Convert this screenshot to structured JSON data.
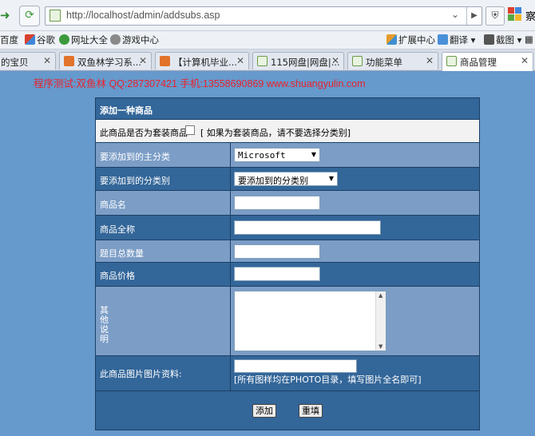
{
  "browser": {
    "url": "http://localhost/admin/addsubs.asp",
    "url_host_part": "http://localhost",
    "url_path_part": "/admin/addsubs.asp",
    "partial_right_text": "察"
  },
  "bookmarks": [
    {
      "label": "百度"
    },
    {
      "label": "谷歌"
    },
    {
      "label": "网址大全"
    },
    {
      "label": "游戏中心"
    },
    {
      "label": "扩展中心"
    },
    {
      "label": "翻译"
    },
    {
      "label": "截图"
    }
  ],
  "tabs": [
    {
      "label": "的宝贝",
      "active": false
    },
    {
      "label": "双鱼林学习系...",
      "active": false
    },
    {
      "label": "【计算机毕业...",
      "active": false
    },
    {
      "label": "115网盘|网盘|...",
      "active": false
    },
    {
      "label": "功能菜单",
      "active": false
    },
    {
      "label": "商品管理",
      "active": true
    }
  ],
  "page": {
    "test_line": "程序测试:双鱼林 QQ:287307421 手机:13558690869 www.shuangyulin.com",
    "form_title": "添加一种商品",
    "set_question": "此商品是否为套装商品",
    "set_note": "[ 如果为套装商品，请不要选择分类别]",
    "main_category_label": "要添加到的主分类",
    "main_category_value": "Microsoft",
    "sub_category_label": "要添加到的分类别",
    "sub_category_value": "要添加到的分类别",
    "name_label": "商品名",
    "fullname_label": "商品全称",
    "count_label": "题目总数量",
    "price_label": "商品价格",
    "other_label": "其他说明",
    "image_label": "此商品图片图片资料:",
    "image_hint": "[所有图样均在PHOTO目录，填写图片全名即可]",
    "add_button": "添加",
    "reset_button": "重填"
  }
}
